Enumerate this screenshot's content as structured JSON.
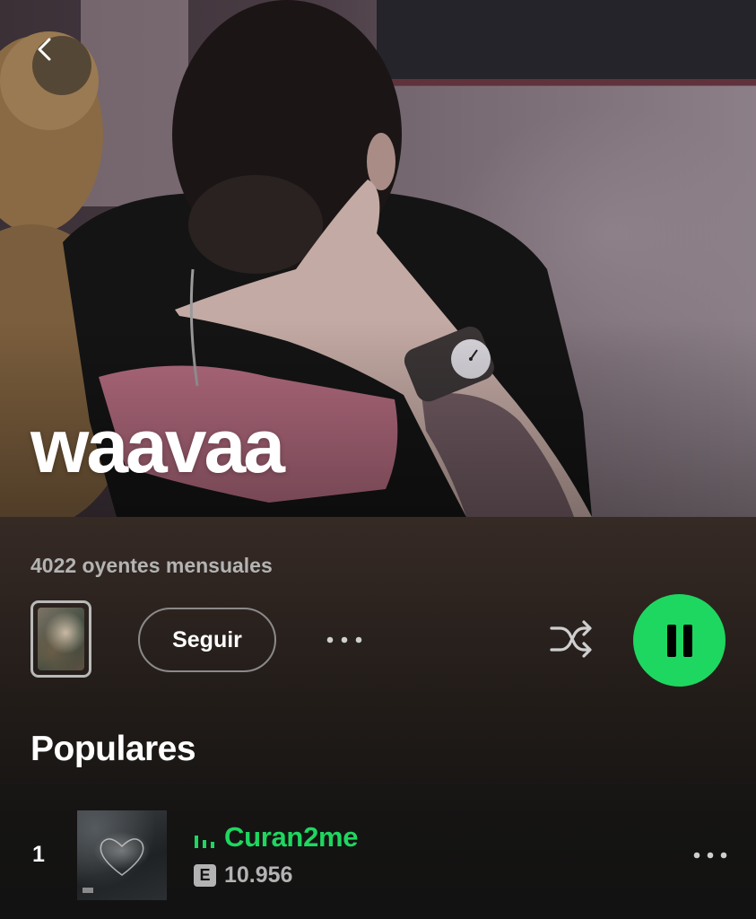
{
  "artist": {
    "name": "waavaa",
    "monthly_listeners": "4022 oyentes mensuales"
  },
  "actions": {
    "follow_label": "Seguir",
    "more_icon": "more-horizontal-icon",
    "shuffle_icon": "shuffle-icon",
    "play_state_icon": "pause-icon"
  },
  "popular": {
    "heading": "Populares",
    "tracks": [
      {
        "index": "1",
        "title": "Curan2me",
        "explicit": "E",
        "plays": "10.956",
        "status_icon": "now-playing-equalizer-icon"
      }
    ]
  },
  "colors": {
    "accent": "#1ed760",
    "background": "#121212",
    "secondary_text": "#b3b3b3"
  }
}
